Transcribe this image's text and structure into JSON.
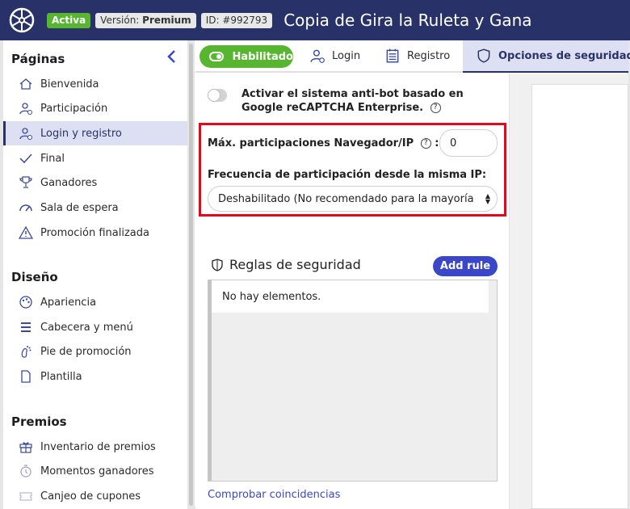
{
  "header": {
    "status_badge": "Activa",
    "version_label": "Versión:",
    "version_value": "Premium",
    "id_badge": "ID: #992793",
    "title": "Copia de Gira la Ruleta y Gana",
    "bg_color": "#283268",
    "logo_icon": "wheel-logo-icon"
  },
  "sidebar": {
    "sections": [
      {
        "title": "Páginas",
        "items": [
          {
            "label": "Bienvenida",
            "icon": "home-icon"
          },
          {
            "label": "Participación",
            "icon": "users-icon"
          },
          {
            "label": "Login y registro",
            "icon": "user-login-icon",
            "active": true
          },
          {
            "label": "Final",
            "icon": "check-icon"
          },
          {
            "label": "Ganadores",
            "icon": "trophy-icon"
          },
          {
            "label": "Sala de espera",
            "icon": "gauge-icon"
          },
          {
            "label": "Promoción finalizada",
            "icon": "warning-icon"
          }
        ]
      },
      {
        "title": "Diseño",
        "items": [
          {
            "label": "Apariencia",
            "icon": "palette-icon"
          },
          {
            "label": "Cabecera y menú",
            "icon": "menu-icon"
          },
          {
            "label": "Pie de promoción",
            "icon": "footprint-icon"
          },
          {
            "label": "Plantilla",
            "icon": "document-icon"
          }
        ]
      },
      {
        "title": "Premios",
        "items": [
          {
            "label": "Inventario de premios",
            "icon": "gift-icon"
          },
          {
            "label": "Momentos ganadores",
            "icon": "clock-icon"
          },
          {
            "label": "Canjeo de cupones",
            "icon": "coupon-icon"
          }
        ]
      }
    ]
  },
  "tabs": {
    "toggle_label": "Habilitado",
    "items": [
      {
        "label": "Login",
        "icon": "user-login-icon"
      },
      {
        "label": "Registro",
        "icon": "form-icon"
      },
      {
        "label": "Opciones de seguridad",
        "icon": "shield-icon",
        "active": true
      }
    ]
  },
  "security": {
    "recaptcha_label": "Activar el sistema anti-bot basado en Google reCAPTCHA Enterprise.",
    "help_glyph": "?",
    "max_participations_label": "Máx. participaciones Navegador/IP",
    "label_colon": ":",
    "max_participations_value": "0",
    "frequency_label": "Frecuencia de participación desde la misma IP:",
    "frequency_selected": "Deshabilitado (No recomendado para la mayoría de casos)",
    "rules_title": "Reglas de seguridad",
    "add_rule_label": "Add rule",
    "empty_text": "No hay elementos.",
    "check_link": "Comprobar coincidencias"
  },
  "colors": {
    "active_green": "#58b530",
    "accent_blue": "#3b47c9",
    "highlight_red": "#e5081a",
    "active_nav_bg": "#dde0f3"
  }
}
